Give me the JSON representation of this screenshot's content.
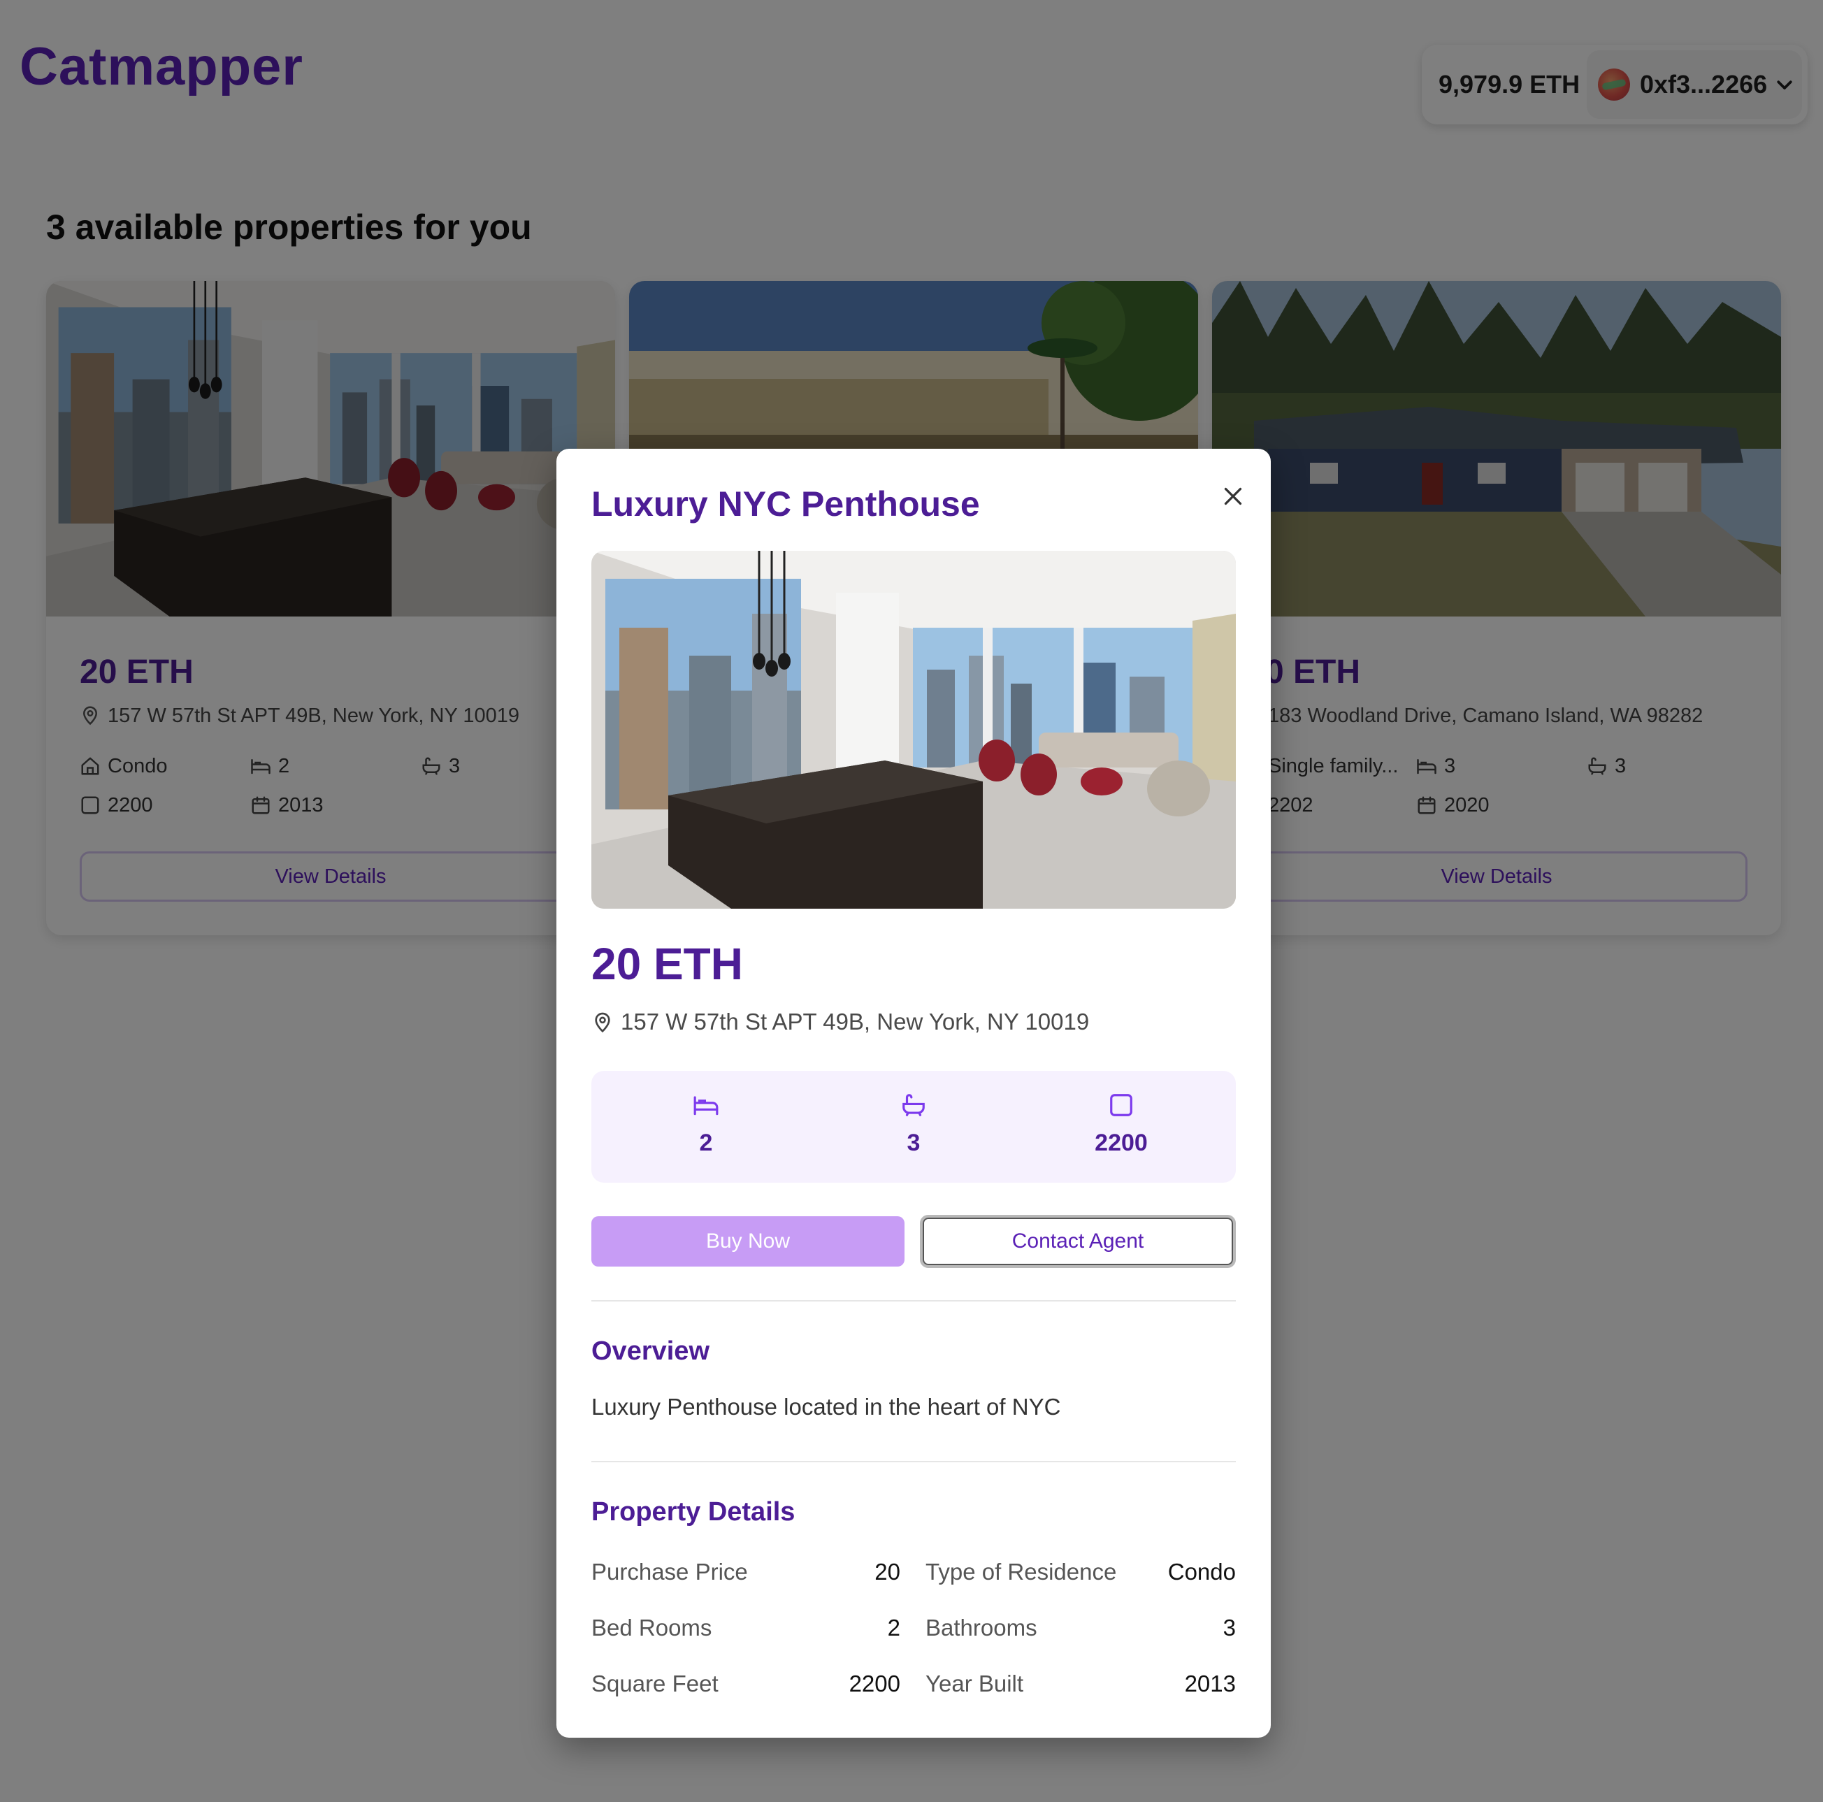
{
  "header": {
    "brand": "Catmapper",
    "wallet": {
      "balance": "9,979.9 ETH",
      "address": "0xf3...2266"
    }
  },
  "listing": {
    "heading": "3 available properties for you",
    "cards": [
      {
        "price": "20 ETH",
        "address": "157 W 57th St APT 49B, New York, NY 10019",
        "type": "Condo",
        "beds": "2",
        "baths": "3",
        "sqft": "2200",
        "year": "2013",
        "button": "View Details"
      },
      {
        "price": "",
        "address": "",
        "type": "",
        "beds": "",
        "baths": "",
        "sqft": "",
        "year": "",
        "button": ""
      },
      {
        "price": "0 ETH",
        "address": "183 Woodland Drive, Camano Island, WA 98282",
        "type": "Single family...",
        "beds": "3",
        "baths": "3",
        "sqft": "2202",
        "year": "2020",
        "button": "View Details"
      }
    ]
  },
  "modal": {
    "title": "Luxury NYC Penthouse",
    "price": "20 ETH",
    "address": "157 W 57th St APT 49B, New York, NY 10019",
    "stats": {
      "beds": "2",
      "baths": "3",
      "sqft": "2200"
    },
    "buy_label": "Buy Now",
    "contact_label": "Contact Agent",
    "overview_heading": "Overview",
    "overview_text": "Luxury Penthouse located in the heart of NYC",
    "details_heading": "Property Details",
    "details": [
      {
        "label": "Purchase Price",
        "value": "20"
      },
      {
        "label": "Type of Residence",
        "value": "Condo"
      },
      {
        "label": "Bed Rooms",
        "value": "2"
      },
      {
        "label": "Bathrooms",
        "value": "3"
      },
      {
        "label": "Square Feet",
        "value": "2200"
      },
      {
        "label": "Year Built",
        "value": "2013"
      }
    ]
  },
  "icons": {
    "close": "close-icon",
    "pin": "location-pin-icon",
    "bed": "bed-icon",
    "bath": "bath-icon",
    "area": "square-area-icon",
    "calendar": "calendar-icon",
    "home": "home-icon",
    "chevron": "chevron-down-icon"
  },
  "colors": {
    "brand": "#5b21b6",
    "accent_dark": "#4c1d95",
    "buy_button": "#c79cf5",
    "stats_bg": "#f6f1fe"
  }
}
